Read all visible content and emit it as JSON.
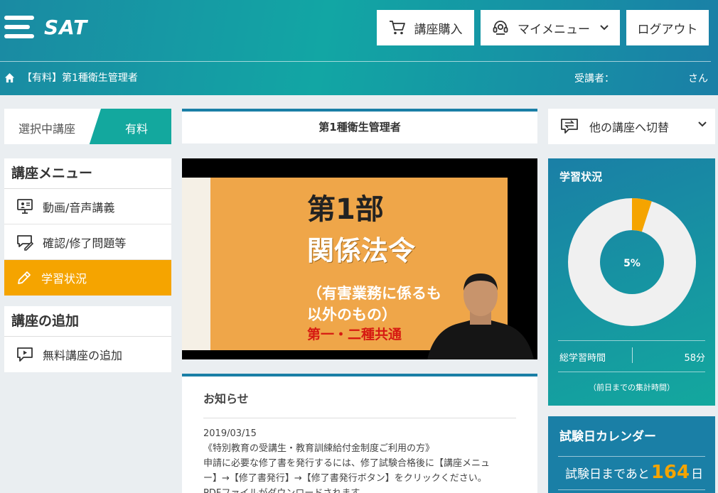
{
  "header": {
    "logo_text": "SAT",
    "buy_label": "講座購入",
    "mymenu_label": "マイメニュー",
    "logout_label": "ログアウト"
  },
  "breadcrumb": {
    "course": "【有料】第1種衛生管理者",
    "user_label": "受講者：",
    "user_suffix": "さん"
  },
  "selected_course": {
    "label": "選択中講座",
    "badge": "有料"
  },
  "course_menu": {
    "title": "講座メニュー",
    "items": [
      {
        "label": "動画/音声講義"
      },
      {
        "label": "確認/修了問題等"
      },
      {
        "label": "学習状況"
      }
    ]
  },
  "add_course": {
    "title": "講座の追加",
    "items": [
      {
        "label": "無料講座の追加"
      }
    ]
  },
  "main": {
    "course_title": "第1種衛生管理者",
    "video": {
      "line1": "第1部",
      "line2": "関係法令",
      "line3": "（有害業務に係るも",
      "line4": "以外のもの）",
      "line5": "第一・二種共通"
    },
    "news": {
      "title": "お知らせ",
      "date": "2019/03/15",
      "line1": "《特別教育の受講生・教育訓練給付金制度ご利用の方》",
      "line2": "申請に必要な修了書を発行するには、修了試験合格後に【講座メニュ",
      "line3": "ー】→【修了書発行】→【修了書発行ボタン】をクリックください。",
      "line4": "PDFファイルがダウンロードされます。"
    }
  },
  "switch": {
    "label": "他の講座へ切替"
  },
  "progress": {
    "title": "学習状況",
    "percent": 5,
    "percent_label": "5%",
    "total_label": "総学習時間",
    "total_value": "58分",
    "note": "（前日までの集計時間）"
  },
  "calendar": {
    "title": "試験日カレンダー",
    "prefix": "試験日まであと",
    "days": "164",
    "suffix": "日"
  },
  "colors": {
    "accent_orange": "#f5a400",
    "teal": "#13a89e",
    "blue": "#1a7fa6"
  }
}
